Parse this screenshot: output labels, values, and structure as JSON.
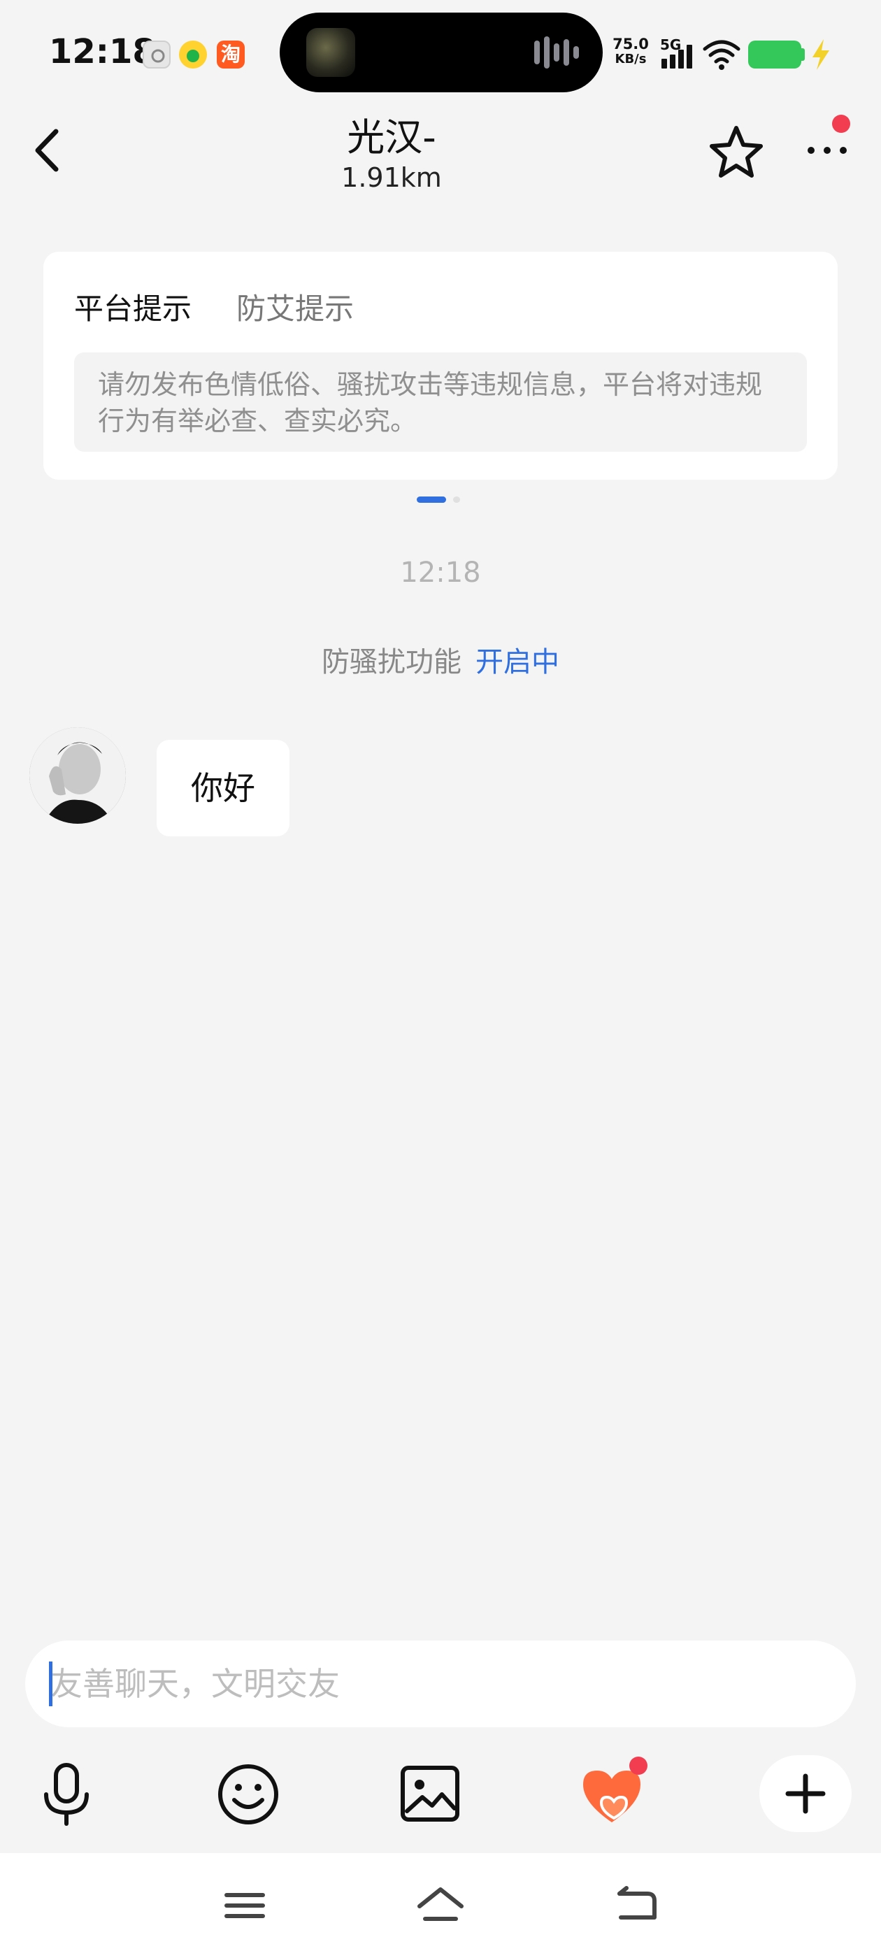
{
  "status_bar": {
    "time": "12:18",
    "net_speed_value": "75.0",
    "net_speed_unit": "KB/s",
    "network_type": "5G",
    "app_icons": [
      "settings-app-icon",
      "qq-music-app-icon",
      "taobao-app-icon"
    ],
    "taobao_glyph": "淘"
  },
  "header": {
    "title": "光汉-",
    "subtitle": "1.91km"
  },
  "notice": {
    "tabs": [
      {
        "label": "平台提示",
        "active": true
      },
      {
        "label": "防艾提示",
        "active": false
      }
    ],
    "body": "请勿发布色情低俗、骚扰攻击等违规信息，平台将对违规行为有举必查、查实必究。"
  },
  "chat": {
    "timestamp": "12:18",
    "anti_harassment_label": "防骚扰功能",
    "anti_harassment_status": "开启中",
    "messages": [
      {
        "from": "other",
        "text": "你好"
      }
    ]
  },
  "composer": {
    "placeholder": "友善聊天，文明交友",
    "value": ""
  },
  "colors": {
    "accent_blue": "#2f6fe0",
    "badge_red": "#f23c4f",
    "heart_orange": "#ff6a3d",
    "battery_green": "#34c759"
  }
}
